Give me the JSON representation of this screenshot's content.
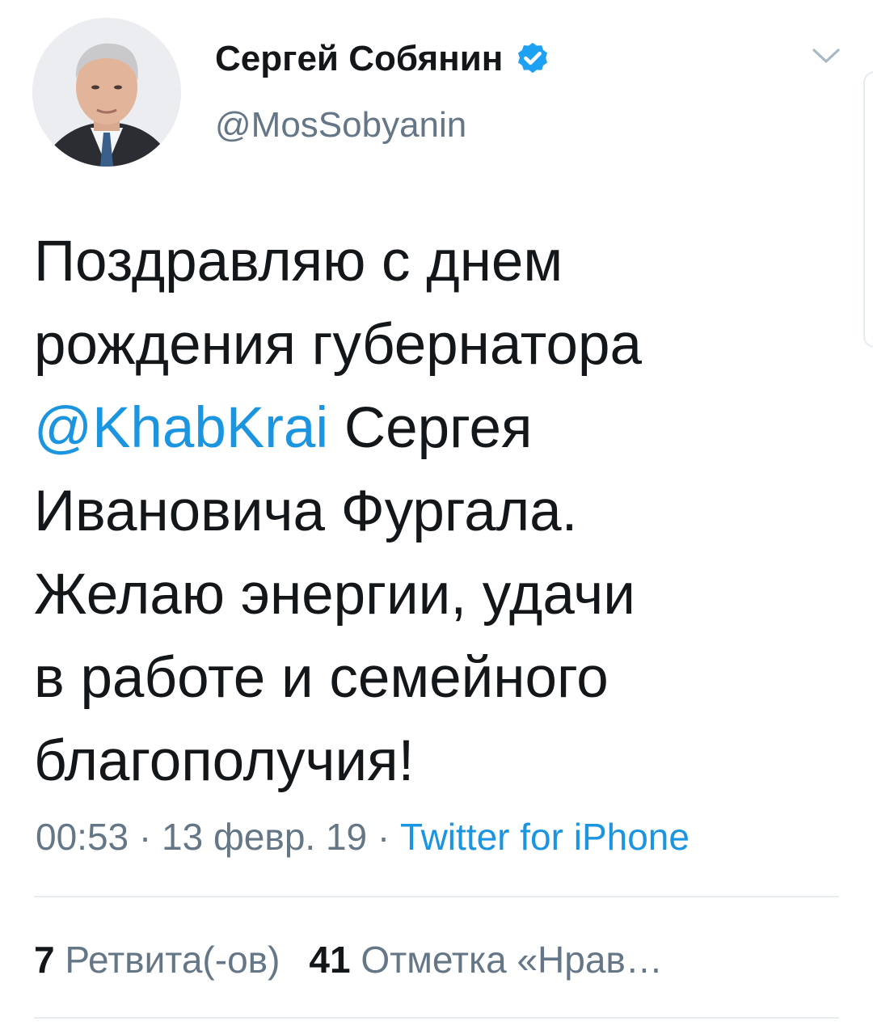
{
  "author": {
    "display_name": "Сергей Собянин",
    "handle": "@MosSobyanin",
    "verified": true
  },
  "tweet": {
    "lines": [
      [
        {
          "text": "Поздравляю с днем",
          "type": "text"
        }
      ],
      [
        {
          "text": "рождения губернатора",
          "type": "text"
        }
      ],
      [
        {
          "text": "@KhabKrai",
          "type": "mention"
        },
        {
          "text": " Сергея",
          "type": "text"
        }
      ],
      [
        {
          "text": "Ивановича Фургала.",
          "type": "text"
        }
      ],
      [
        {
          "text": "Желаю энергии, удачи",
          "type": "text"
        }
      ],
      [
        {
          "text": "в работе и семейного",
          "type": "text"
        }
      ],
      [
        {
          "text": "благополучия!",
          "type": "text"
        }
      ]
    ],
    "time": "00:53",
    "date": "13 февр. 19",
    "separator": " · ",
    "source": "Twitter for iPhone"
  },
  "stats": {
    "retweets_count": "7",
    "retweets_label": " Ретвита(-ов)",
    "likes_count": "41",
    "likes_label": " Отметка «Нрав…"
  },
  "icons": {
    "verified_badge": "verified-badge-icon",
    "more_menu": "chevron-down-icon"
  },
  "colors": {
    "link": "#1b95e0",
    "text": "#14171a",
    "secondary": "#657786",
    "divider": "#e6ecf0"
  }
}
